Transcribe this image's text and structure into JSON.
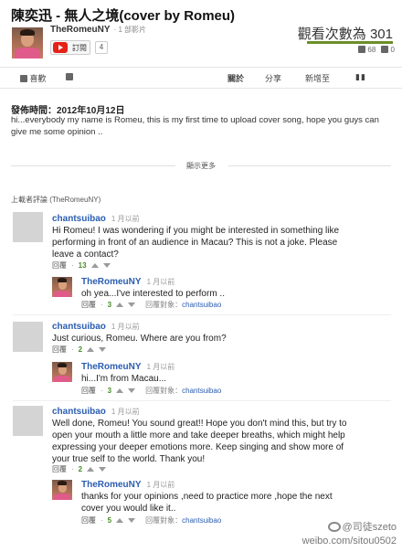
{
  "video": {
    "title": "陳奕迅 - 無人之境(cover by Romeu)",
    "channel_name": "TheRomeuNY",
    "channel_video_count": "· 1 部影片",
    "subscribe_label": "訂閱",
    "subscriber_count": "4",
    "views_text": "觀看次數為 301",
    "likes": "68",
    "dislikes": "0"
  },
  "actions": {
    "like_label": "喜歡",
    "about_label": "關於",
    "share_label": "分享",
    "add_to_label": "新增至"
  },
  "description": {
    "published": "發佈時間：2012年10月12日",
    "text": "hi...everybody my name is Romeu, this is my first time to upload cover song, hope you guys can give me some opinion ..",
    "show_more": "顯示更多"
  },
  "comments_header": "上載者評論 (TheRomeuNY)",
  "comments": [
    {
      "author": "chantsuibao",
      "time": "1 月以前",
      "text": "Hi Romeu! I was wondering if you might be interested in something like performing in front of an audience in Macau? This is not a joke. Please leave a contact?",
      "reply_label": "回覆",
      "votes": "13",
      "reply": {
        "author": "TheRomeuNY",
        "time": "1 月以前",
        "text": "oh yea...I've interested to perform ..",
        "reply_label": "回覆",
        "votes": "3",
        "reply_to_label": "回覆對象：",
        "reply_to_name": "chantsuibao"
      }
    },
    {
      "author": "chantsuibao",
      "time": "1 月以前",
      "text": "Just curious, Romeu. Where are you from?",
      "reply_label": "回覆",
      "votes": "2",
      "reply": {
        "author": "TheRomeuNY",
        "time": "1 月以前",
        "text": "hi...I'm from Macau...",
        "reply_label": "回覆",
        "votes": "3",
        "reply_to_label": "回覆對象：",
        "reply_to_name": "chantsuibao"
      }
    },
    {
      "author": "chantsuibao",
      "time": "1 月以前",
      "text": "Well done, Romeu! You sound great!! Hope you don't mind this, but try to open your mouth a little more and take deeper breaths, which might help expressing your deeper emotions more. Keep singing and show more of your true self to the world. Thank you!",
      "reply_label": "回覆",
      "votes": "2",
      "reply": {
        "author": "TheRomeuNY",
        "time": "1 月以前",
        "text": "thanks for your opinions ,need to practice more ,hope the next cover you would like it..",
        "reply_label": "回覆",
        "votes": "5",
        "reply_to_label": "回覆對象：",
        "reply_to_name": "chantsuibao"
      }
    }
  ],
  "watermark": {
    "handle": "@司徒szeto",
    "url": "weibo.com/sitou0502"
  },
  "colors": {
    "link": "#2a5db0",
    "positive": "#4a8a2a",
    "youtube_red": "#e62117",
    "views_bar": "#6b8f2a"
  }
}
